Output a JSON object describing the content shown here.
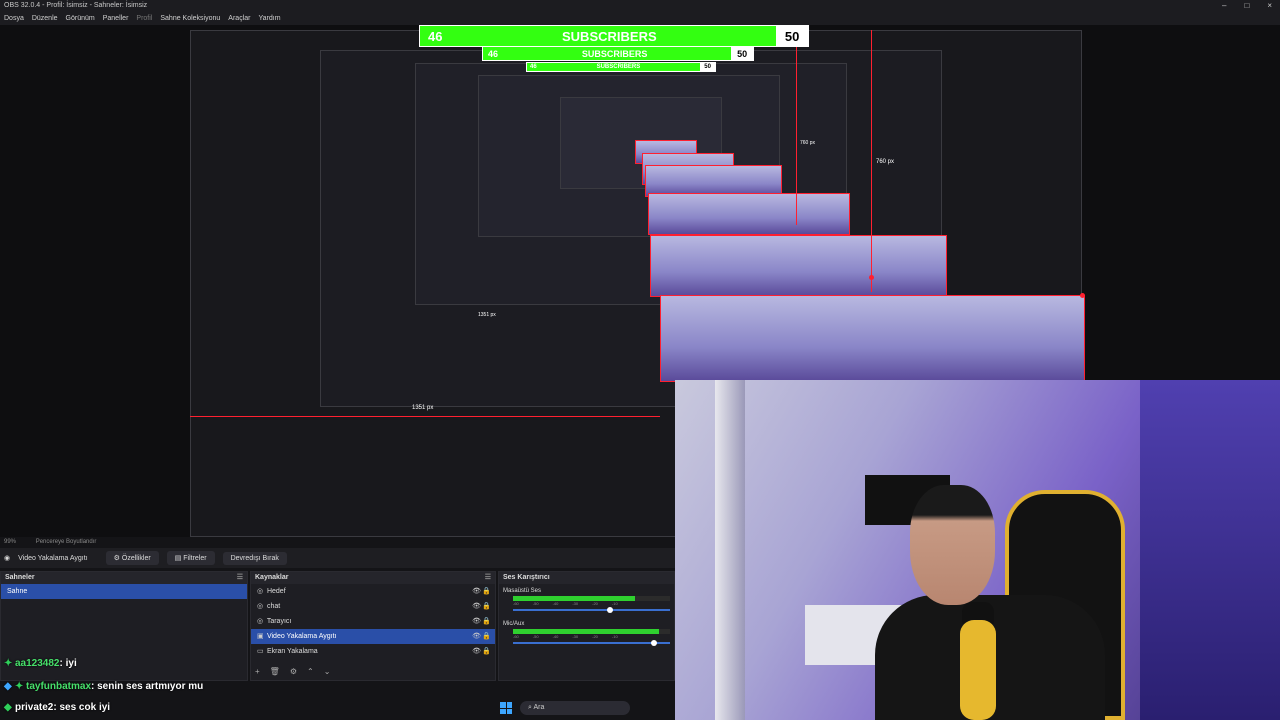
{
  "window": {
    "title": "OBS 32.0.4 - Profil: İsimsiz - Sahneler: İsimsiz",
    "controls": [
      "–",
      "□",
      "×"
    ]
  },
  "menu": [
    "Dosya",
    "Düzenle",
    "Görünüm",
    "Paneller",
    "Profil",
    "Sahne Koleksiyonu",
    "Araçlar",
    "Yardım"
  ],
  "overlay": {
    "subscribers_label": "SUBSCRIBERS",
    "current": "46",
    "goal": "50",
    "colors": {
      "bar": "#33ff11",
      "border": "#ffffff",
      "guide": "#ff2030"
    }
  },
  "guides": {
    "height_label": "760 px",
    "width_label": "1351 px",
    "small_label": "760 px",
    "tiny_label": "1351 px"
  },
  "status": {
    "zoom": "99%",
    "fit": "Pencereye Boyutlandır"
  },
  "toolbar": {
    "source_name": "Video Yakalama Aygıtı",
    "properties": "Özellikler",
    "filters": "Filtreler",
    "deactivate": "Devredışı Bırak"
  },
  "scenes": {
    "title": "Sahneler",
    "items": [
      "Sahne"
    ]
  },
  "sources": {
    "title": "Kaynaklar",
    "items": [
      {
        "label": "Hedef",
        "icon": "globe-icon"
      },
      {
        "label": "chat",
        "icon": "globe-icon"
      },
      {
        "label": "Tarayıcı",
        "icon": "globe-icon"
      },
      {
        "label": "Video Yakalama Aygıtı",
        "icon": "camera-icon",
        "selected": true
      },
      {
        "label": "Ekran Yakalama",
        "icon": "monitor-icon"
      }
    ]
  },
  "mixer": {
    "title": "Ses Karıştırıcı",
    "channels": [
      {
        "name": "Masaüstü Ses",
        "level": 0.78,
        "volume": 0.62
      },
      {
        "name": "Mic/Aux",
        "level": 0.93,
        "volume": 0.9
      }
    ],
    "ticks": [
      "-60",
      "-55",
      "-50",
      "-45",
      "-40",
      "-35",
      "-30",
      "-25",
      "-20",
      "-15",
      "-10",
      "-5",
      "0"
    ]
  },
  "chat": [
    {
      "user": "aa123482",
      "message": ": iyi"
    },
    {
      "user": "tayfunbatmax",
      "message": ": senin ses artmıyor mu"
    },
    {
      "user": "private2",
      "message": ": ses cok iyi"
    }
  ],
  "taskbar": {
    "search_placeholder": "Ara"
  }
}
